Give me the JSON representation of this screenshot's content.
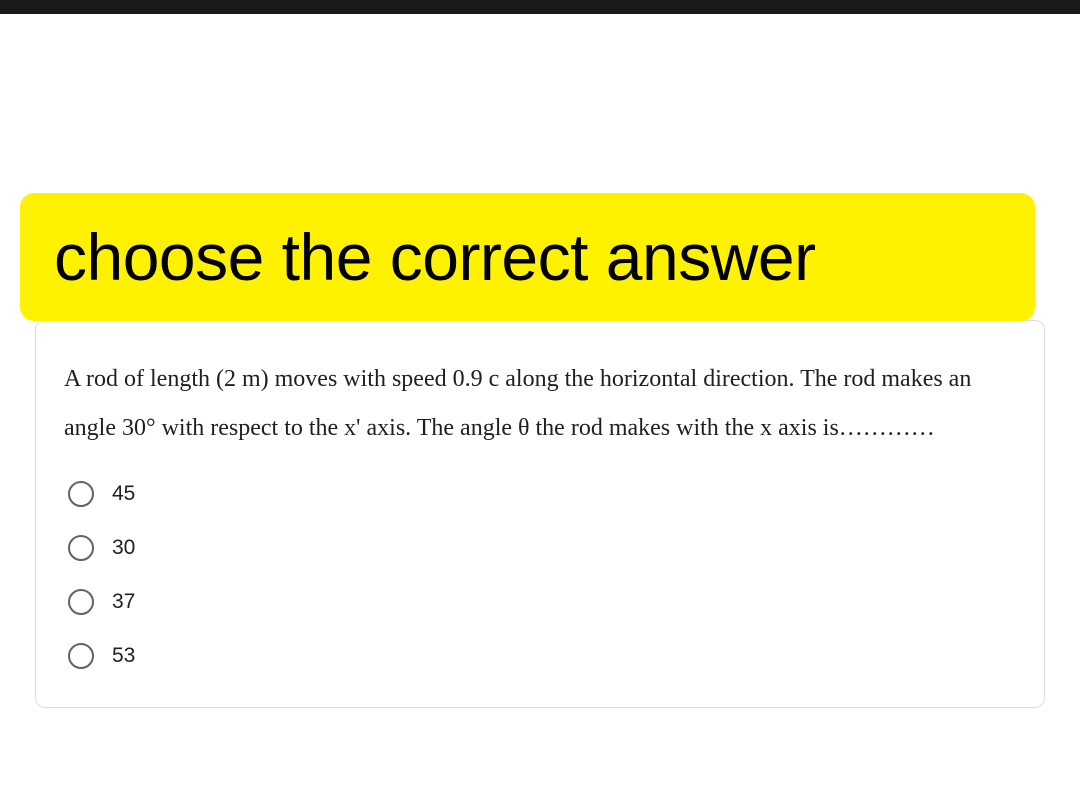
{
  "banner": {
    "title": "choose the correct answer"
  },
  "question": {
    "text": "A rod of length (2 m) moves with speed 0.9 c along the horizontal direction. The rod makes an angle 30° with respect to the x'  axis. The angle θ the rod makes with the x axis is…………"
  },
  "options": [
    {
      "label": "45"
    },
    {
      "label": "30"
    },
    {
      "label": "37"
    },
    {
      "label": "53"
    }
  ]
}
